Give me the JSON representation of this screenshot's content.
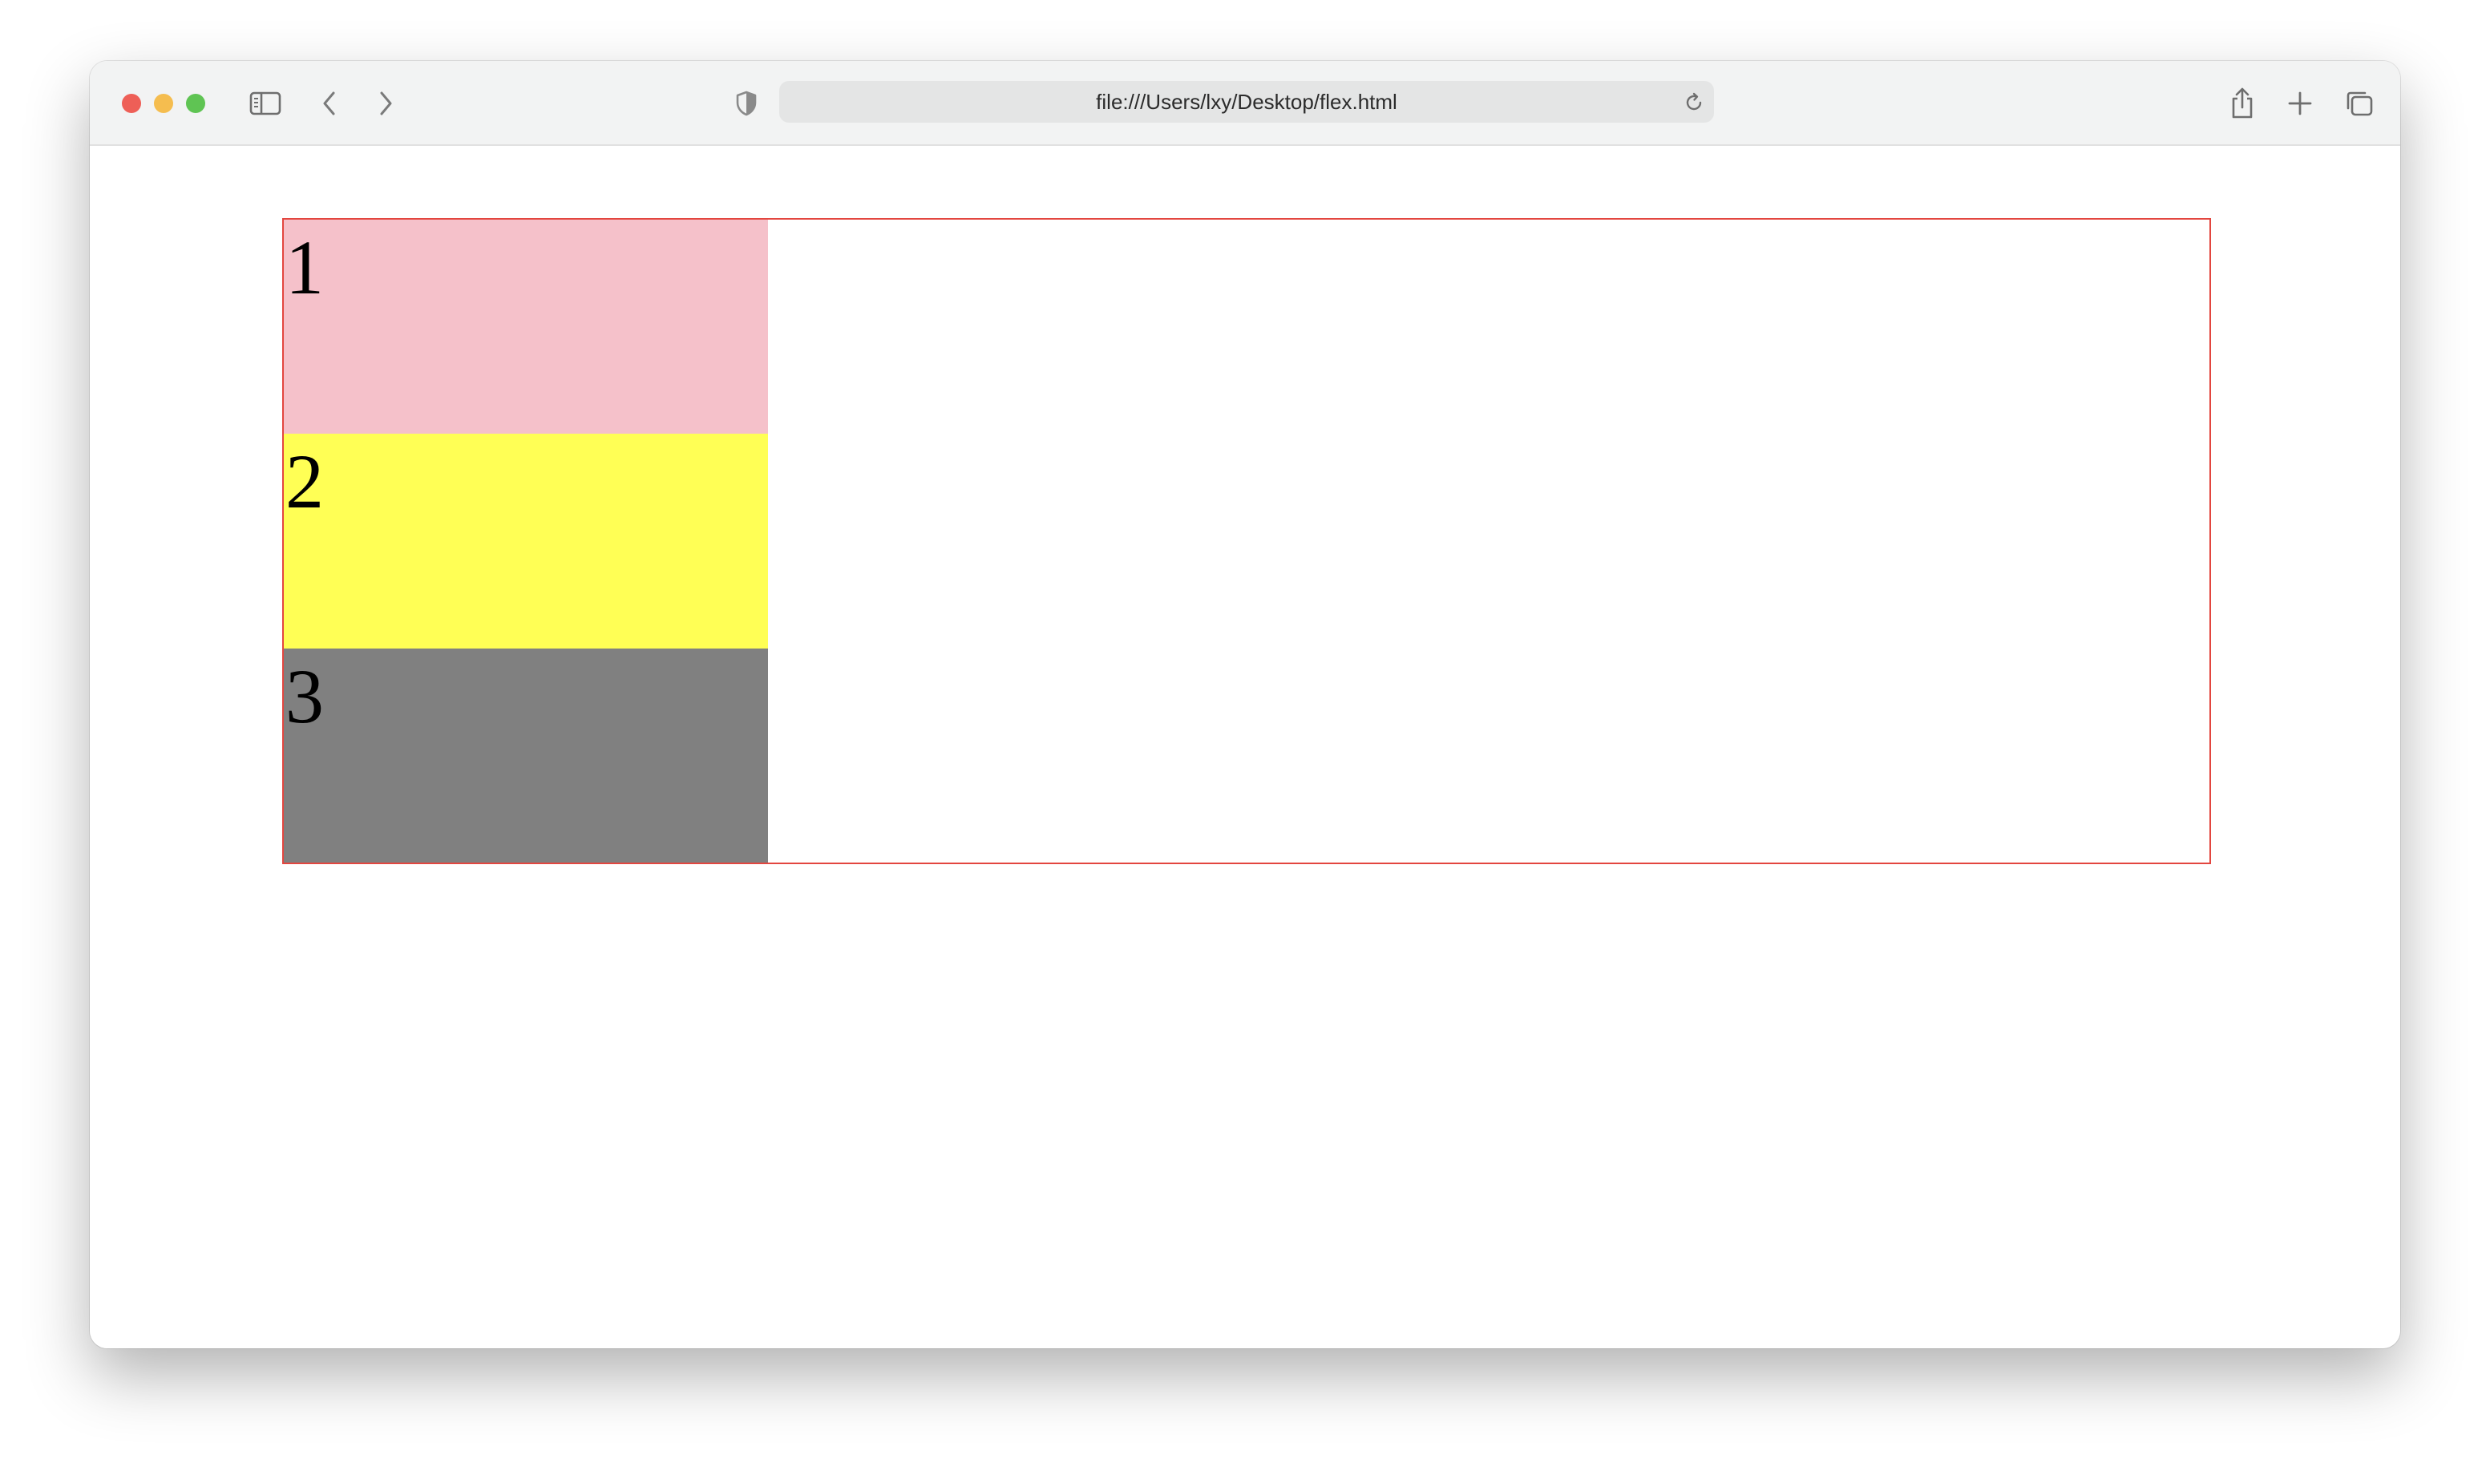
{
  "browser": {
    "url": "file:///Users/lxy/Desktop/flex.html",
    "icons": {
      "sidebar": "sidebar-icon",
      "back": "chevron-left-icon",
      "forward": "chevron-right-icon",
      "privacy": "shield-icon",
      "reload": "reload-icon",
      "share": "share-icon",
      "new_tab": "plus-icon",
      "tabs": "tab-overview-icon"
    }
  },
  "page": {
    "container_border_color": "#e3463f",
    "items": [
      {
        "label": "1",
        "color": "#f5c1ca"
      },
      {
        "label": "2",
        "color": "#ffff55"
      },
      {
        "label": "3",
        "color": "#808080"
      }
    ]
  }
}
